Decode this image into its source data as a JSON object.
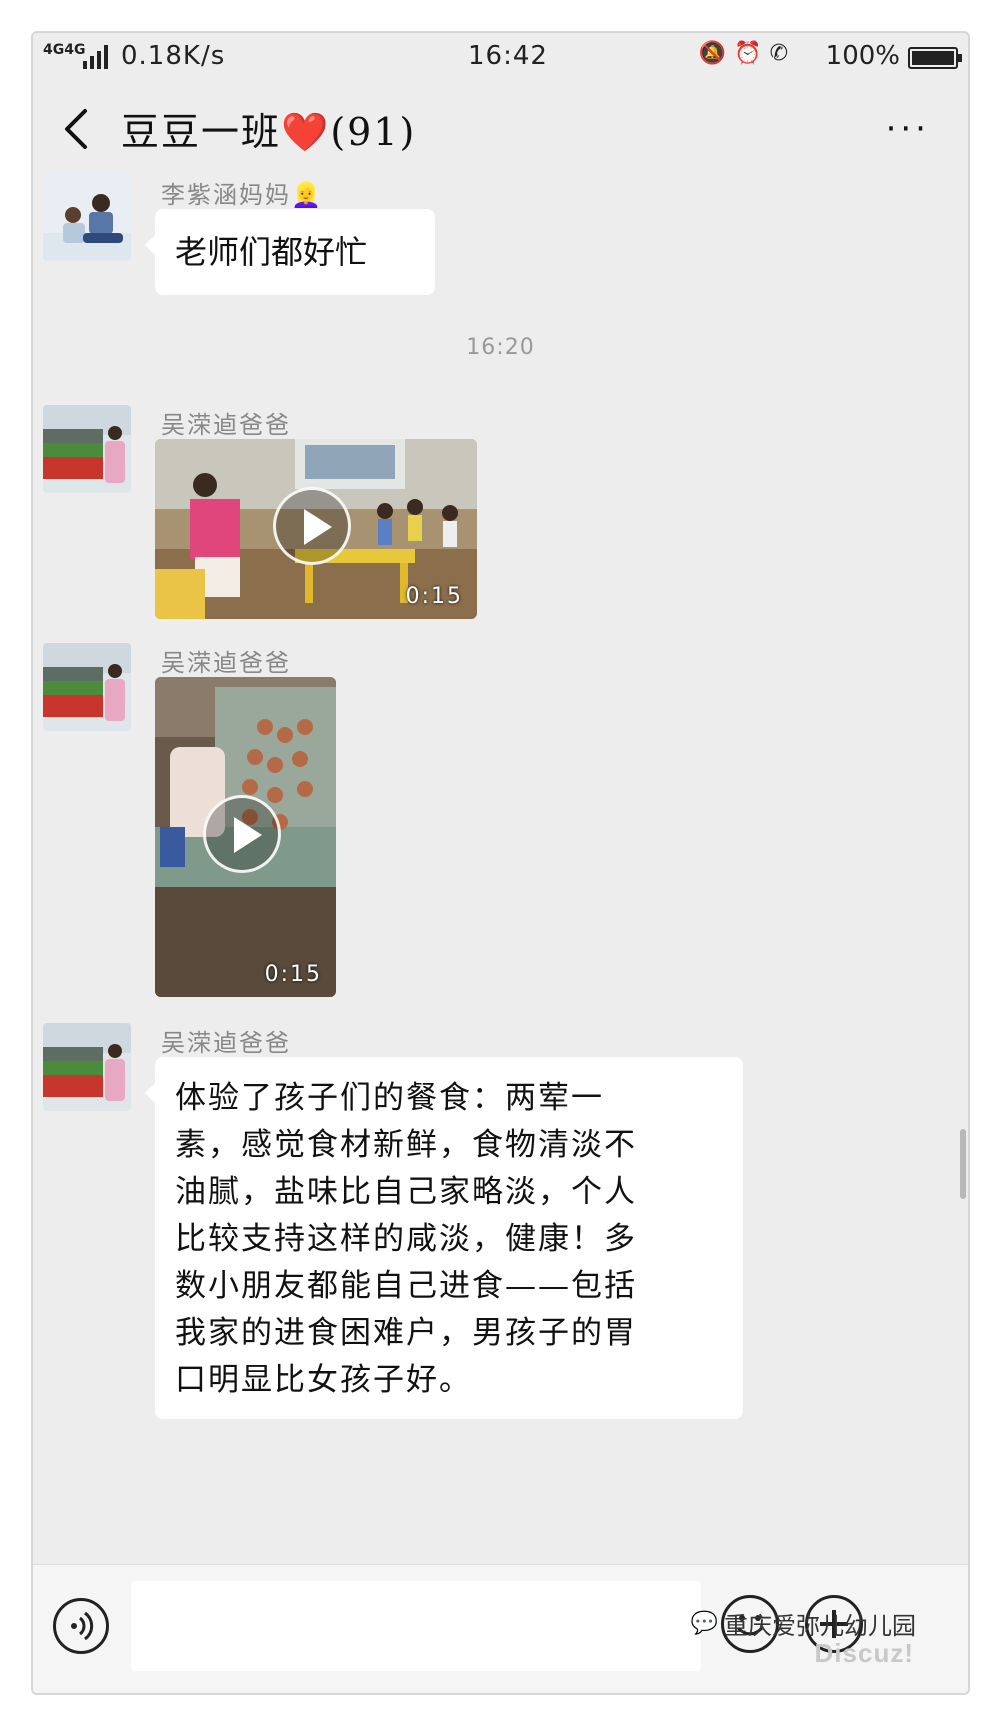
{
  "status_bar": {
    "network": "4G4G",
    "speed": "0.18K/s",
    "time": "16:42",
    "icons": [
      "mute-bell-icon",
      "alarm-icon",
      "hd-call-icon"
    ],
    "battery": "100%"
  },
  "header": {
    "title": "豆豆一班❤️(91)",
    "more": "···"
  },
  "messages": [
    {
      "type": "text",
      "sender": "李紫涵妈妈👱‍♀️",
      "text": "老师们都好忙"
    },
    {
      "type": "time",
      "text": "16:20"
    },
    {
      "type": "video",
      "sender": "吴溁逌爸爸",
      "duration": "0:15"
    },
    {
      "type": "video",
      "sender": "吴溁逌爸爸",
      "duration": "0:15"
    },
    {
      "type": "text",
      "sender": "吴溁逌爸爸",
      "lines": [
        "体验了孩子们的餐食：两荤一",
        "素，感觉食材新鲜，食物清淡不",
        "油腻，盐味比自己家略淡，个人",
        "比较支持这样的咸淡，健康！多",
        "数小朋友都能自己进食——包括",
        "我家的进食困难户，男孩子的胃",
        "口明显比女孩子好。"
      ]
    }
  ],
  "input_bar": {
    "placeholder": "",
    "voice_icon": "voice-icon",
    "emoji_icon": "emoji-icon",
    "plus_icon": "plus-icon"
  },
  "watermark": {
    "text": "重庆爱弥儿幼儿园",
    "site": "Discuz!"
  }
}
